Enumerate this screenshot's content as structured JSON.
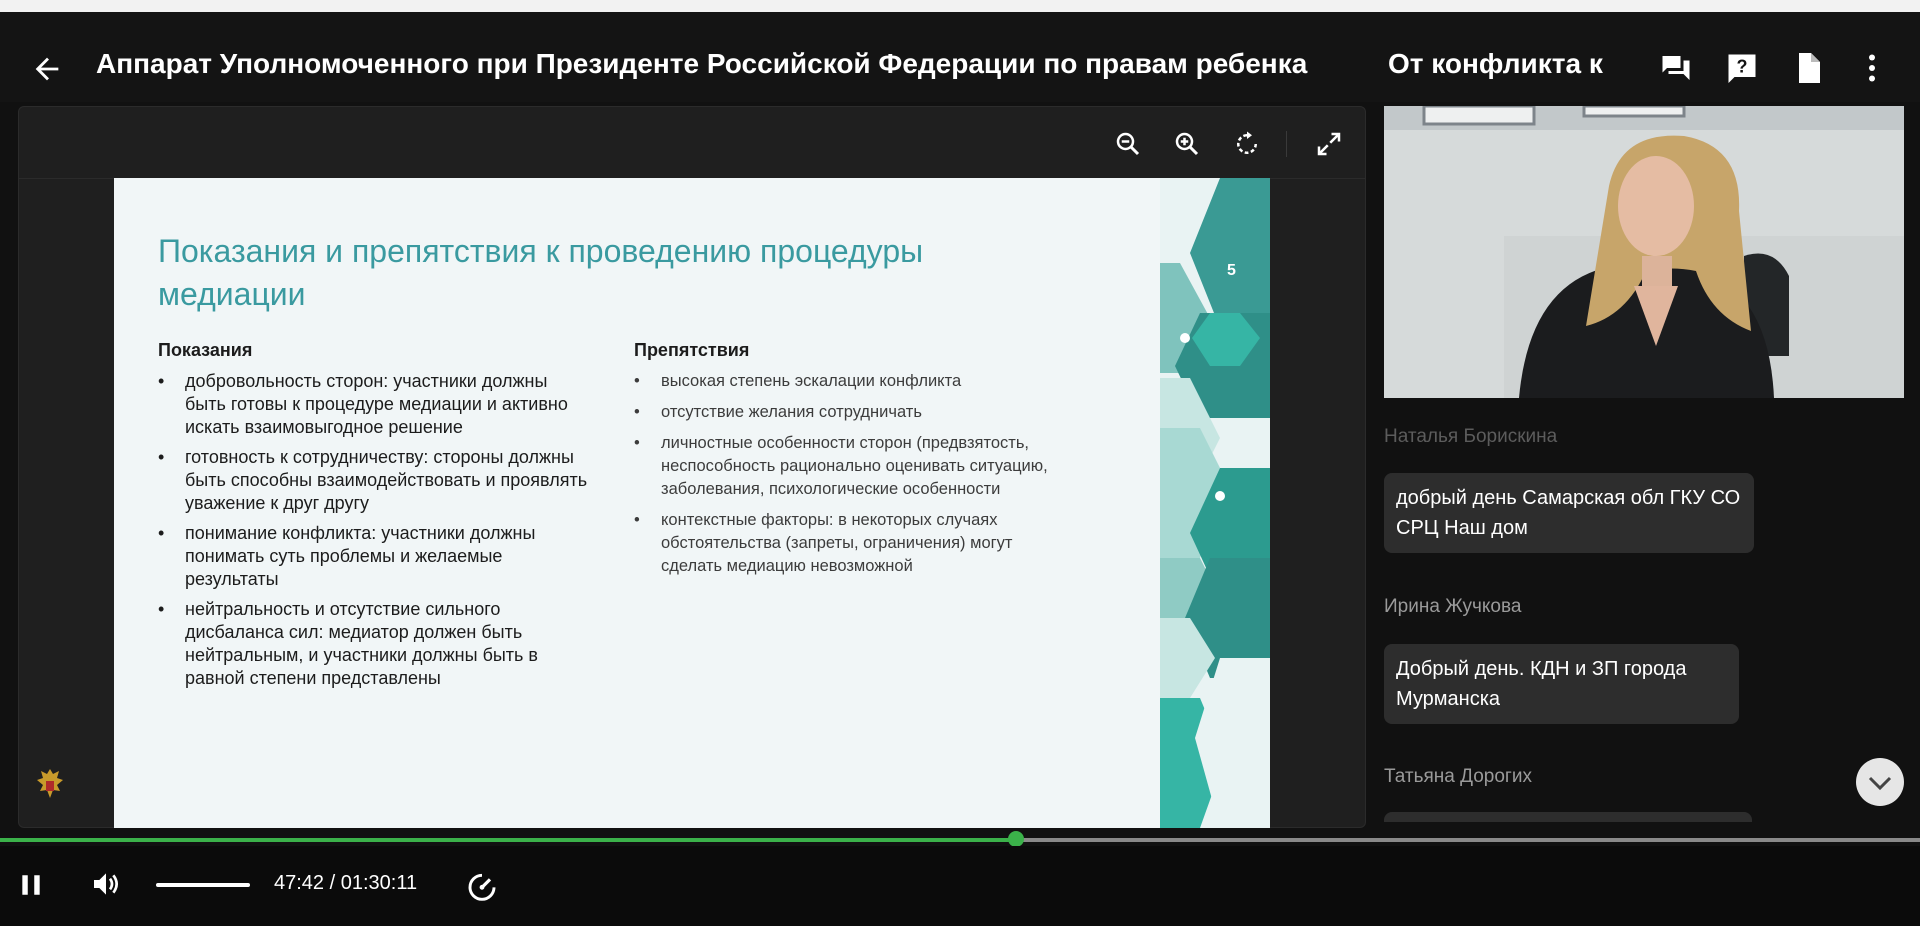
{
  "header": {
    "title": "Аппарат Уполномоченного при Президенте Российской Федерации по правам ребенка",
    "title_continued": "От конфликта к",
    "icons": [
      "back-arrow-icon",
      "chat-icon",
      "help-icon",
      "document-icon",
      "more-vertical-icon"
    ]
  },
  "viewer": {
    "tools": [
      "zoom-out-icon",
      "zoom-in-icon",
      "rotate-icon",
      "fullscreen-icon"
    ]
  },
  "slide": {
    "title": "Показания и препятствия к проведению процедуры медиации",
    "page_number": "5",
    "indications": {
      "heading": "Показания",
      "items": [
        "добровольность сторон: участники должны быть готовы к процедуре медиации и активно искать взаимовыгодное решение",
        "готовность к сотрудничеству: стороны должны быть способны взаимодействовать и проявлять уважение к друг другу",
        "понимание конфликта: участники должны понимать суть проблемы и желаемые результаты",
        "нейтральность и отсутствие сильного дисбаланса сил: медиатор должен быть нейтральным, и участники должны быть в равной степени представлены"
      ]
    },
    "obstacles": {
      "heading": "Препятствия",
      "items": [
        "высокая степень эскалации конфликта",
        "отсутствие желания сотрудничать",
        "личностные особенности сторон (предвзятость, неспособность рационально оценивать ситуацию, заболевания, психологические особенности",
        "контекстные факторы: в некоторых случаях обстоятельства (запреты, ограничения) могут сделать медиацию невозможной"
      ]
    }
  },
  "chat": {
    "messages": [
      {
        "author": "Наталья Борискина",
        "text": "добрый день Самарская обл ГКУ СО СРЦ Наш дом"
      },
      {
        "author": "Ирина Жучкова",
        "text": "Добрый день. КДН и ЗП города Мурманска"
      },
      {
        "author": "Татьяна Дорогих",
        "text": ""
      }
    ]
  },
  "player": {
    "state": "playing",
    "time": "47:42 / 01:30:11",
    "progress": 0.529,
    "volume": 1.0,
    "colors": {
      "accent": "#3bb24a",
      "slide_accent": "#3a9aa0"
    }
  }
}
